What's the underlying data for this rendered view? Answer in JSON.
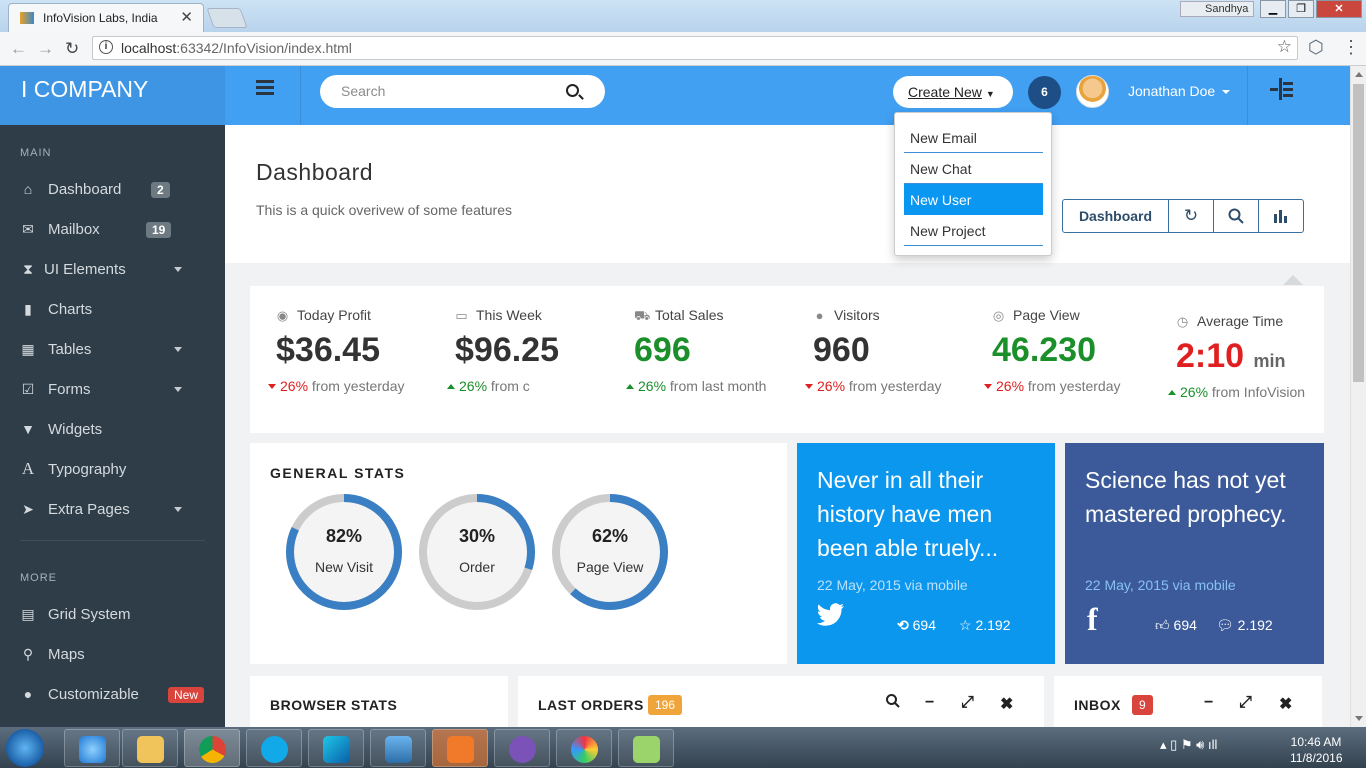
{
  "browser": {
    "tab_title": "InfoVision Labs, India",
    "tab_close": "✕",
    "url_host": "localhost",
    "url_rest": ":63342/InfoVision/index.html",
    "user_chip": "Sandhya"
  },
  "brand": "I COMPANY",
  "sidebar": {
    "main_label": "MAIN",
    "more_label": "MORE",
    "main_items": [
      {
        "label": "Dashboard",
        "badge": "2"
      },
      {
        "label": "Mailbox",
        "badge": "19"
      },
      {
        "label": "UI Elements"
      },
      {
        "label": "Charts"
      },
      {
        "label": "Tables"
      },
      {
        "label": "Forms"
      },
      {
        "label": "Widgets"
      },
      {
        "label": "Typography"
      },
      {
        "label": "Extra Pages"
      }
    ],
    "more_items": [
      {
        "label": "Grid System"
      },
      {
        "label": "Maps"
      },
      {
        "label": "Customizable",
        "badge": "New"
      }
    ]
  },
  "header": {
    "search_placeholder": "Search",
    "create_new": "Create New",
    "notifications": "6",
    "user_name": "Jonathan Doe"
  },
  "create_menu": [
    "New Email",
    "New Chat",
    "New User",
    "New Project"
  ],
  "page": {
    "title": "Dashboard",
    "subtitle": "This is a quick overivew of some features",
    "button_dashboard": "Dashboard"
  },
  "stats": [
    {
      "label": "Today Profit",
      "value": "$36.45",
      "change": "26%",
      "suffix": "from yesterday",
      "trend": "down",
      "value_color": "#333333"
    },
    {
      "label": "This Week",
      "value": "$96.25",
      "change": "26%",
      "suffix": "from c",
      "trend": "up",
      "value_color": "#333333"
    },
    {
      "label": "Total Sales",
      "value": "696",
      "change": "26%",
      "suffix": "from last month",
      "trend": "up",
      "value_color": "#1a8f2a"
    },
    {
      "label": "Visitors",
      "value": "960",
      "change": "26%",
      "suffix": "from yesterday",
      "trend": "down",
      "value_color": "#333333"
    },
    {
      "label": "Page View",
      "value": "46.230",
      "change": "26%",
      "suffix": "from yesterday",
      "trend": "down",
      "value_color": "#1a8f2a"
    },
    {
      "label": "Average Time",
      "value": "2:10",
      "unit": "min",
      "change": "26%",
      "suffix": "from InfoVision",
      "trend": "up",
      "value_color": "#e02020"
    }
  ],
  "general_stats": {
    "title": "GENERAL STATS",
    "donuts": [
      {
        "percent_text": "82%",
        "fraction": 0.82,
        "name": "New Visit"
      },
      {
        "percent_text": "30%",
        "fraction": 0.3,
        "name": "Order"
      },
      {
        "percent_text": "62%",
        "fraction": 0.62,
        "name": "Page View"
      }
    ]
  },
  "quotes": {
    "twitter": {
      "text": "Never in all their history have men been able truely...",
      "meta": "22 May, 2015 via mobile",
      "retweets": "694",
      "favorites": "2.192"
    },
    "facebook": {
      "text": "Science has not yet mastered prophecy.",
      "meta": "22 May, 2015 via mobile",
      "likes": "694",
      "comments": "2.192"
    }
  },
  "widgets": {
    "browser_stats": "BROWSER STATS",
    "last_orders": "LAST ORDERS",
    "last_orders_count": "196",
    "inbox": "INBOX",
    "inbox_count": "9"
  },
  "taskbar": {
    "time": "10:46 AM",
    "date": "11/8/2016"
  },
  "colors": {
    "brand_blue": "#3d95e4",
    "topbar": "#41a0f2",
    "sidebar": "#2f3d48",
    "twitter": "#0c97ee",
    "facebook": "#3c5a99",
    "donut_fill": "#3a7fc3",
    "donut_track": "#cccccc"
  }
}
